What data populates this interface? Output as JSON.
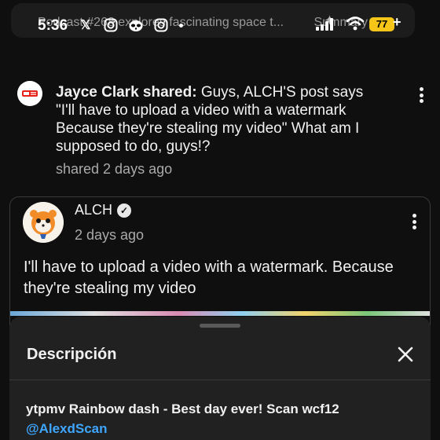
{
  "status_bar": {
    "time": "5:36",
    "battery": "77",
    "battery_plus": "+",
    "notification_icons": [
      "x-icon",
      "instagram-icon",
      "raccoon-icon",
      "instagram-icon",
      "dot"
    ]
  },
  "mini_player": {
    "title": "Podcast #268 explores fascinating space t...",
    "right_label": "Summary",
    "icons": [
      "sparkle-icon",
      "chevron-down-icon"
    ]
  },
  "post": {
    "sharer": "Jayce Clark shared:",
    "text": " Guys, ALCH'S post says \"I'll have to upload a video with a watermark Because they're stealing my video\" What am I supposed to do, guys!?",
    "meta": "shared 2 days ago",
    "avatar_label": "YouTube Kids"
  },
  "shared_card": {
    "author": "ALCH",
    "time": "2 days ago",
    "text": "I'll have to upload a video with a watermark. Because they're stealing my video"
  },
  "description_sheet": {
    "title": "Descripción",
    "line1": "ytpmv Rainbow dash - Best day ever! Scan wcf12",
    "link": "@AlexdScan"
  },
  "colors": {
    "background": "#0f0f0f",
    "sheet": "#212121",
    "link": "#3ea6ff",
    "battery": "#f5c518"
  }
}
